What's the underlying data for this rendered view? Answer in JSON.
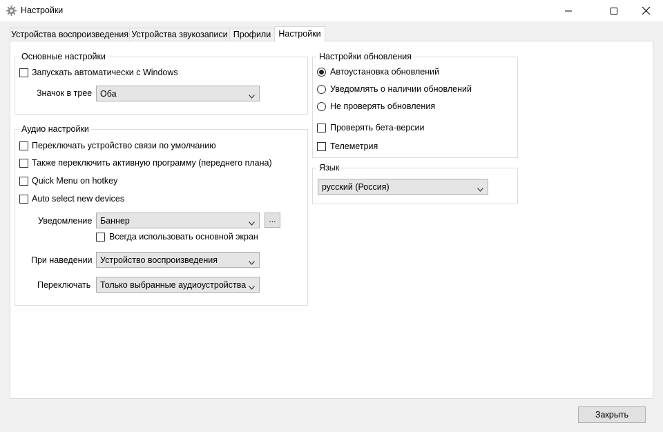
{
  "window": {
    "title": "Настройки",
    "icon": "gear-icon",
    "controls": [
      "minimize-icon",
      "maximize-icon",
      "close-icon"
    ]
  },
  "tabs": [
    {
      "label": "Устройства воспроизведения",
      "active": false
    },
    {
      "label": "Устройства звукозаписи",
      "active": false
    },
    {
      "label": "Профили",
      "active": false
    },
    {
      "label": "Настройки",
      "active": true
    }
  ],
  "basic": {
    "title": "Основные настройки",
    "autostart": {
      "label": "Запускать автоматически с Windows",
      "checked": false
    },
    "tray_icon": {
      "label": "Значок в трее",
      "value": "Оба"
    }
  },
  "audio": {
    "title": "Аудио настройки",
    "checkboxes": [
      {
        "label": "Переключать устройство связи по умолчанию",
        "checked": false
      },
      {
        "label": "Также переключить активную программу (переднего плана)",
        "checked": false
      },
      {
        "label": "Quick Menu on hotkey",
        "checked": false
      },
      {
        "label": "Auto select new devices",
        "checked": false
      }
    ],
    "notification": {
      "label": "Уведомление",
      "value": "Баннер",
      "more_button": "..."
    },
    "primary_screen": {
      "label": "Всегда использовать основной экран",
      "checked": false
    },
    "on_hover": {
      "label": "При наведении",
      "value": "Устройство воспроизведения"
    },
    "switch": {
      "label": "Переключать",
      "value": "Только выбранные аудиоустройства"
    }
  },
  "updates": {
    "title": "Настройки обновления",
    "radios": [
      {
        "label": "Автоустановка обновлений",
        "checked": true
      },
      {
        "label": "Уведомлять о наличии обновлений",
        "checked": false
      },
      {
        "label": "Не проверять обновления",
        "checked": false
      }
    ],
    "beta": {
      "label": "Проверять бета-версии",
      "checked": false
    },
    "telemetry": {
      "label": "Телеметрия",
      "checked": false
    }
  },
  "language": {
    "title": "Язык",
    "value": "русский (Россия)"
  },
  "footer": {
    "close_button": "Закрыть"
  }
}
